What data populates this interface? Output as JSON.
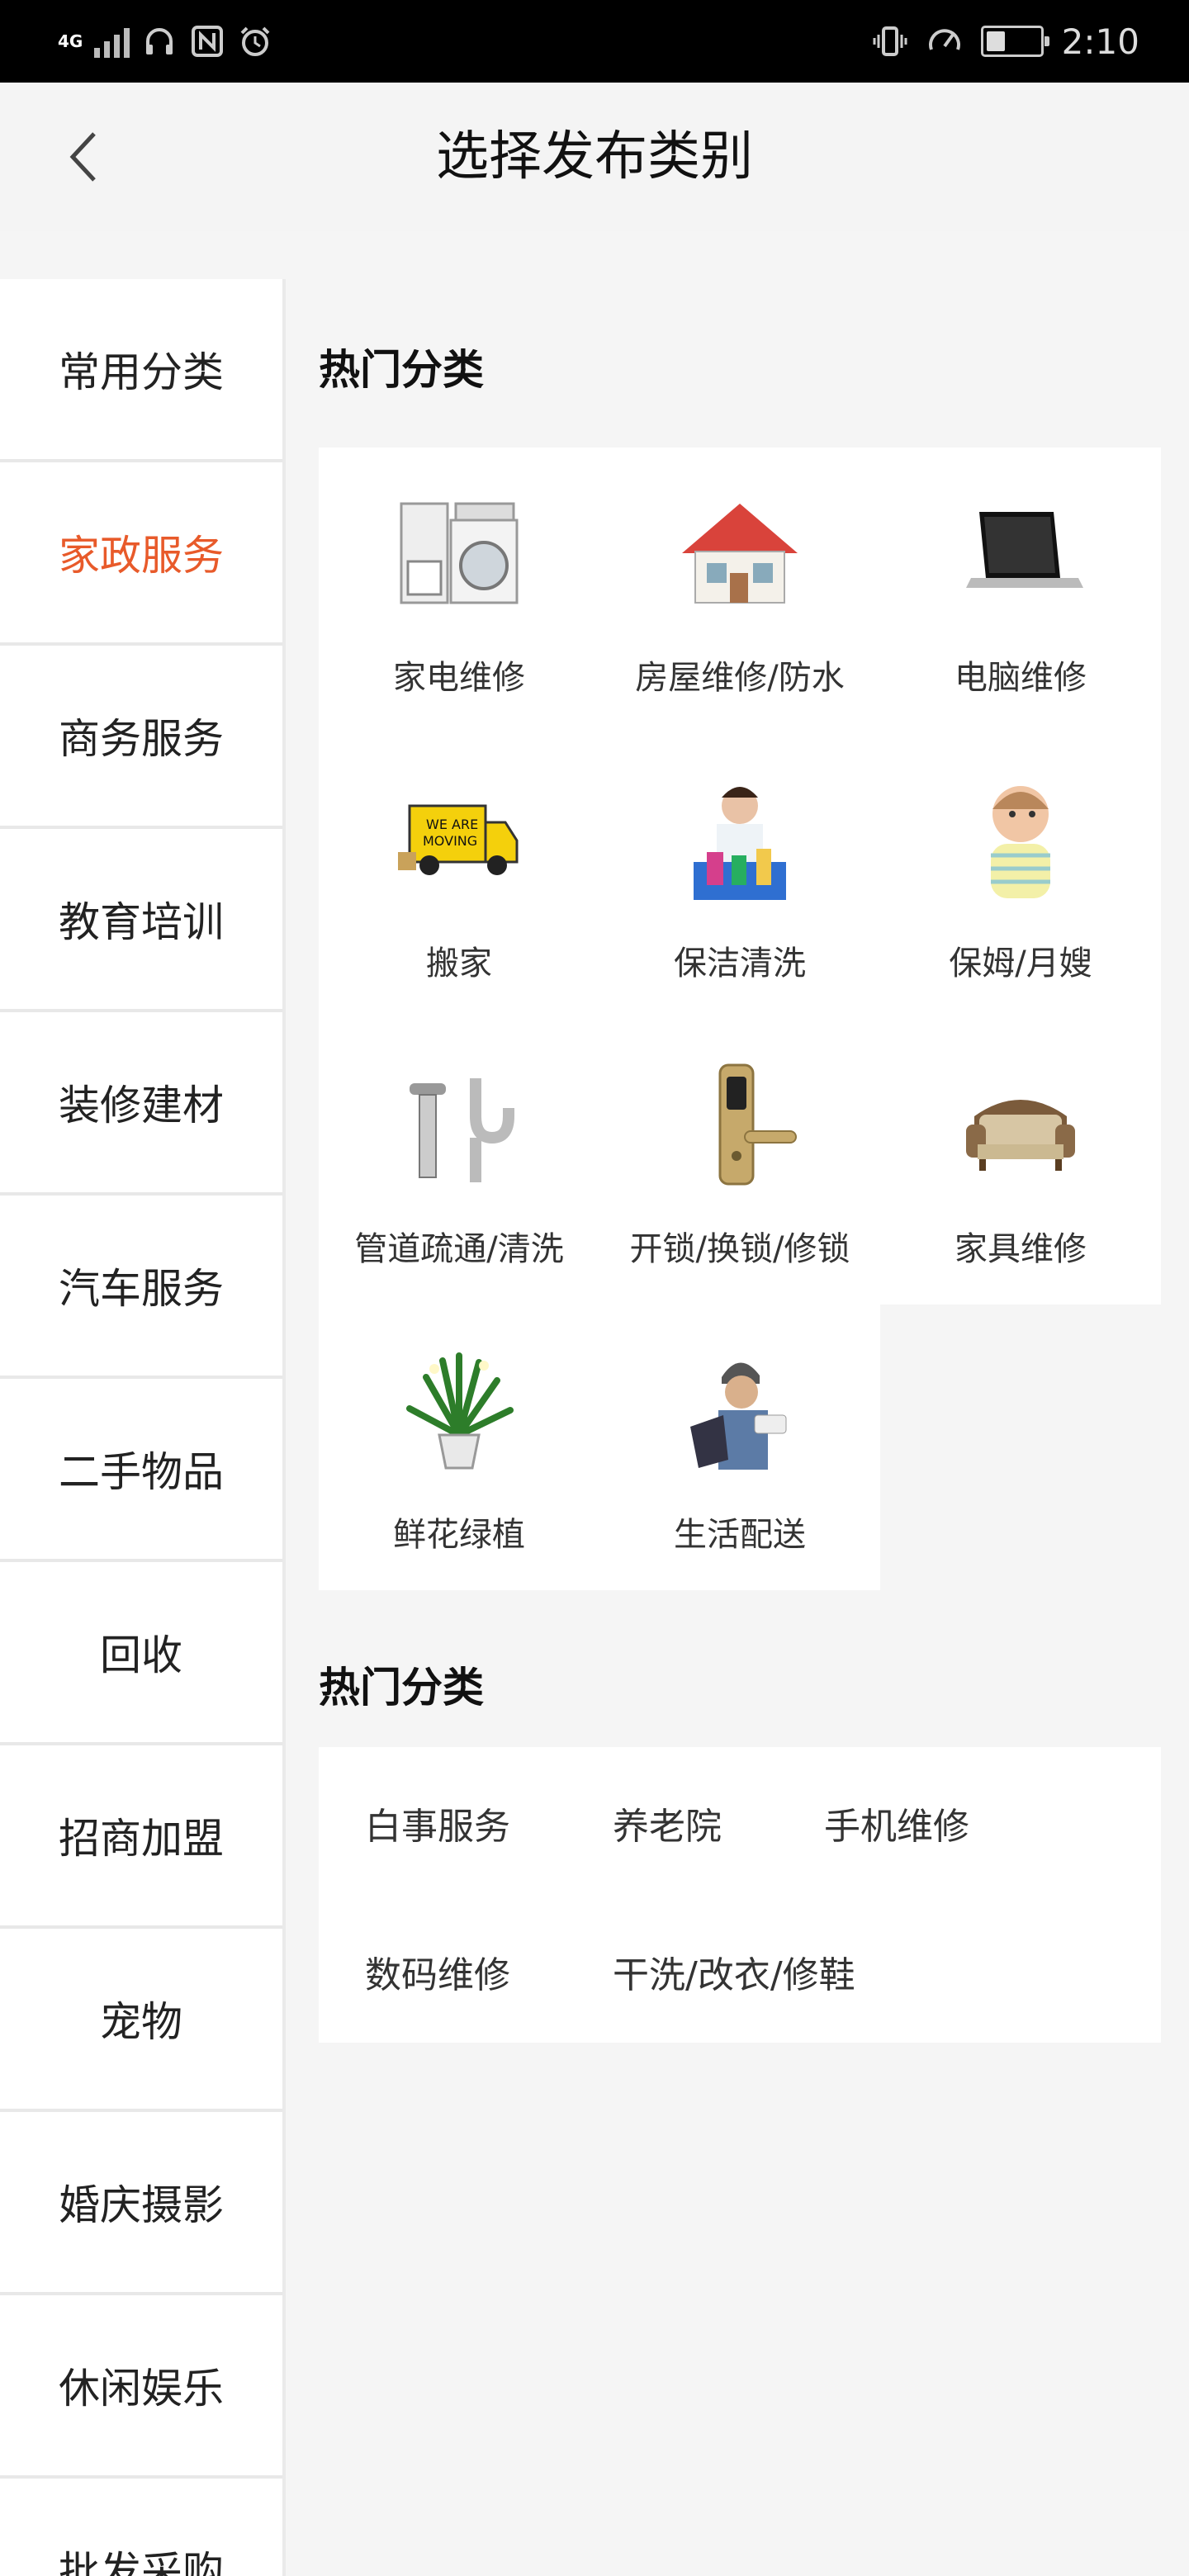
{
  "status_bar": {
    "network": "4G",
    "time": "2:10",
    "battery_level": 0.35
  },
  "header": {
    "title": "选择发布类别"
  },
  "sidebar": {
    "items": [
      {
        "label": "常用分类",
        "active": false
      },
      {
        "label": "家政服务",
        "active": true
      },
      {
        "label": "商务服务",
        "active": false
      },
      {
        "label": "教育培训",
        "active": false
      },
      {
        "label": "装修建材",
        "active": false
      },
      {
        "label": "汽车服务",
        "active": false
      },
      {
        "label": "二手物品",
        "active": false
      },
      {
        "label": "回收",
        "active": false
      },
      {
        "label": "招商加盟",
        "active": false
      },
      {
        "label": "宠物",
        "active": false
      },
      {
        "label": "婚庆摄影",
        "active": false
      },
      {
        "label": "休闲娱乐",
        "active": false
      },
      {
        "label": "批发采购",
        "active": false
      }
    ]
  },
  "hot_section": {
    "title": "热门分类",
    "items": [
      {
        "label": "家电维修",
        "icon": "appliance-icon"
      },
      {
        "label": "房屋维修/防水",
        "icon": "house-icon"
      },
      {
        "label": "电脑维修",
        "icon": "laptop-icon"
      },
      {
        "label": "搬家",
        "icon": "moving-truck-icon"
      },
      {
        "label": "保洁清洗",
        "icon": "cleaner-icon"
      },
      {
        "label": "保姆/月嫂",
        "icon": "baby-icon"
      },
      {
        "label": "管道疏通/清洗",
        "icon": "pipe-icon"
      },
      {
        "label": "开锁/换锁/修锁",
        "icon": "door-lock-icon"
      },
      {
        "label": "家具维修",
        "icon": "sofa-icon"
      },
      {
        "label": "鲜花绿植",
        "icon": "plant-icon"
      },
      {
        "label": "生活配送",
        "icon": "courier-icon"
      }
    ]
  },
  "tag_section": {
    "title": "热门分类",
    "items": [
      "白事服务",
      "养老院",
      "手机维修",
      "数码维修",
      "干洗/改衣/修鞋"
    ]
  },
  "colors": {
    "accent": "#e85a2a",
    "background": "#f5f5f5",
    "card": "#ffffff"
  }
}
